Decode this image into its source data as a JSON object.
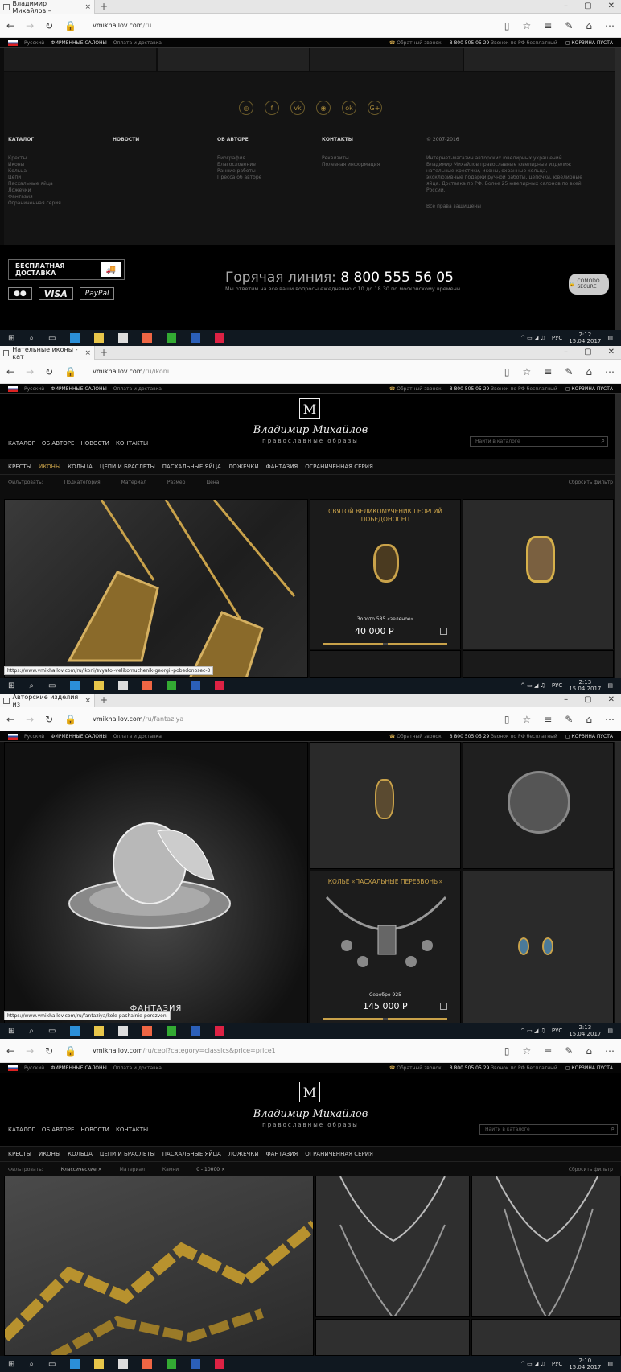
{
  "screens": [
    {
      "tab_title": "Владимир Михайлов –",
      "url_host": "vmikhailov.com",
      "url_path": "/ru",
      "time": "2:12",
      "date": "15.04.2017"
    },
    {
      "tab_title": "Нательные иконы - кат",
      "url_host": "vmikhailov.com",
      "url_path": "/ru/ikoni",
      "time": "2:13",
      "date": "15.04.2017",
      "status_url": "https://www.vmikhailov.com/ru/ikoni/svyatoi-velikomuchenik-georgii-pobedonosec-3"
    },
    {
      "tab_title": "Авторские изделия из",
      "url_host": "vmikhailov.com",
      "url_path": "/ru/fantaziya",
      "time": "2:13",
      "date": "15.04.2017",
      "status_url": "https://www.vmikhailov.com/ru/fantaziya/kole-pashalnie-perezvoni"
    },
    {
      "tab_title": "",
      "url_host": "vmikhailov.com",
      "url_path": "/ru/cepi?category=classics&price=price1",
      "time": "2:10",
      "date": "15.04.2017"
    }
  ],
  "topbar": {
    "lang": "Русский",
    "salons": "ФИРМЕННЫЕ САЛОНЫ",
    "delivery": "Оплата и доставка",
    "callback": "Обратный звонок",
    "phone": "8 800 505 05 29",
    "phone_note": "Звонок по РФ бесплатный",
    "cart": "КОРЗИНА ПУСТА"
  },
  "social": [
    "◎",
    "f",
    "vk",
    "◉",
    "ok",
    "G+"
  ],
  "footer": {
    "cols": [
      {
        "title": "КАТАЛОГ",
        "items": [
          "Кресты",
          "Иконы",
          "Кольца",
          "Цепи",
          "Пасхальные яйца",
          "Ложечки",
          "Фантазия",
          "Ограниченная серия"
        ]
      },
      {
        "title": "НОВОСТИ",
        "items": []
      },
      {
        "title": "ОБ АВТОРЕ",
        "items": [
          "Биография",
          "Благословение",
          "Ранние работы",
          "Пресса об авторе"
        ]
      },
      {
        "title": "КОНТАКТЫ",
        "items": [
          "Реквизиты",
          "Полезная информация"
        ]
      },
      {
        "title": "© 2007-2016",
        "items": [
          "Интернет-магазин авторских ювелирных украшений",
          "Владимир Михайлов православные ювелирные изделия:",
          "нательные крестики, иконы, охранные кольца,",
          "эксклюзивные подарки ручной работы, цепочки, ювелирные",
          "яйца. Доставка по РФ. Более 25 ювелирных салонов по всей",
          "России.",
          "",
          "Все права защищены"
        ]
      }
    ],
    "free_delivery": "БЕСПЛАТНАЯ ДОСТАВКА",
    "cards": [
      "●●",
      "VISA",
      "PayPal"
    ],
    "hotline_label": "Горячая линия:",
    "hotline_number": "8 800 555 56 05",
    "hotline_sub": "Мы ответим на все ваши вопросы ежедневно с 10 до 18.30 по московскому времени",
    "comodo": "COMODO SECURE"
  },
  "header": {
    "logo_mark": "М",
    "logo_title": "Владимир Михайлов",
    "logo_sub": "православные образы",
    "nav": [
      "КАТАЛОГ",
      "ОБ АВТОРЕ",
      "НОВОСТИ",
      "КОНТАКТЫ"
    ],
    "search_placeholder": "Найти в каталоге",
    "catnav": [
      "КРЕСТЫ",
      "ИКОНЫ",
      "КОЛЬЦА",
      "ЦЕПИ И БРАСЛЕТЫ",
      "ПАСХАЛЬНЫЕ ЯЙЦА",
      "ЛОЖЕЧКИ",
      "ФАНТАЗИЯ",
      "ОГРАНИЧЕННАЯ СЕРИЯ"
    ]
  },
  "filters_icons": {
    "label": "Фильтровать:",
    "items": [
      "Подкатегория",
      "Материал",
      "Размер",
      "Цена"
    ],
    "reset": "Сбросить фильтр"
  },
  "filters_chains": {
    "label": "Фильтровать:",
    "items": [
      "Классические  ×",
      "Материал",
      "Камни",
      "0 - 10000  ×"
    ],
    "reset": "Сбросить фильтр"
  },
  "product_george": {
    "title": "СВЯТОЙ ВЕЛИКОМУЧЕНИК ГЕОРГИЙ ПОБЕДОНОСЕЦ",
    "material": "Золото 585 «зеленое»",
    "price": "40 000 Р"
  },
  "product_bells": {
    "title": "КОЛЬЕ «ПАСХАЛЬНЫЕ ПЕРЕЗВОНЫ»",
    "material": "Серебро 925",
    "price": "145 000 Р"
  },
  "fantasy_caption": "ФАНТАЗИЯ",
  "taskbar": {
    "lang": "РУС"
  }
}
